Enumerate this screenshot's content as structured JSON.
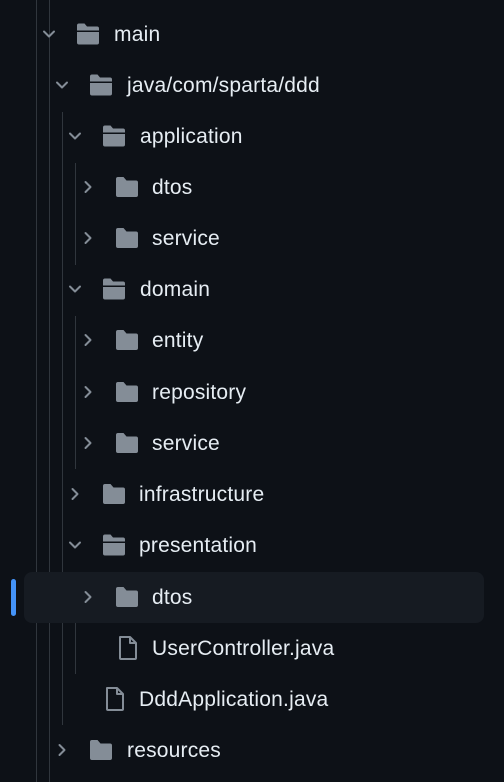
{
  "tree": {
    "items": [
      {
        "label": "main",
        "type": "folder",
        "expanded": true,
        "icon": "folder-open-icon"
      },
      {
        "label": "java/com/sparta/ddd",
        "type": "folder",
        "expanded": true,
        "icon": "folder-open-icon"
      },
      {
        "label": "application",
        "type": "folder",
        "expanded": true,
        "icon": "folder-open-icon"
      },
      {
        "label": "dtos",
        "type": "folder",
        "expanded": false,
        "icon": "folder-icon"
      },
      {
        "label": "service",
        "type": "folder",
        "expanded": false,
        "icon": "folder-icon"
      },
      {
        "label": "domain",
        "type": "folder",
        "expanded": true,
        "icon": "folder-open-icon"
      },
      {
        "label": "entity",
        "type": "folder",
        "expanded": false,
        "icon": "folder-icon"
      },
      {
        "label": "repository",
        "type": "folder",
        "expanded": false,
        "icon": "folder-icon"
      },
      {
        "label": "service",
        "type": "folder",
        "expanded": false,
        "icon": "folder-icon"
      },
      {
        "label": "infrastructure",
        "type": "folder",
        "expanded": false,
        "icon": "folder-icon"
      },
      {
        "label": "presentation",
        "type": "folder",
        "expanded": true,
        "icon": "folder-open-icon"
      },
      {
        "label": "dtos",
        "type": "folder",
        "expanded": false,
        "icon": "folder-icon",
        "selected": true
      },
      {
        "label": "UserController.java",
        "type": "file",
        "icon": "file-icon"
      },
      {
        "label": "DddApplication.java",
        "type": "file",
        "icon": "file-icon"
      },
      {
        "label": "resources",
        "type": "folder",
        "expanded": false,
        "icon": "folder-icon"
      }
    ]
  },
  "colors": {
    "background": "#0d1117",
    "text": "#e6edf3",
    "icon": "#848d97",
    "selected_row": "#161b22",
    "selection_marker": "#4493f8",
    "guide_line": "#30363d"
  }
}
